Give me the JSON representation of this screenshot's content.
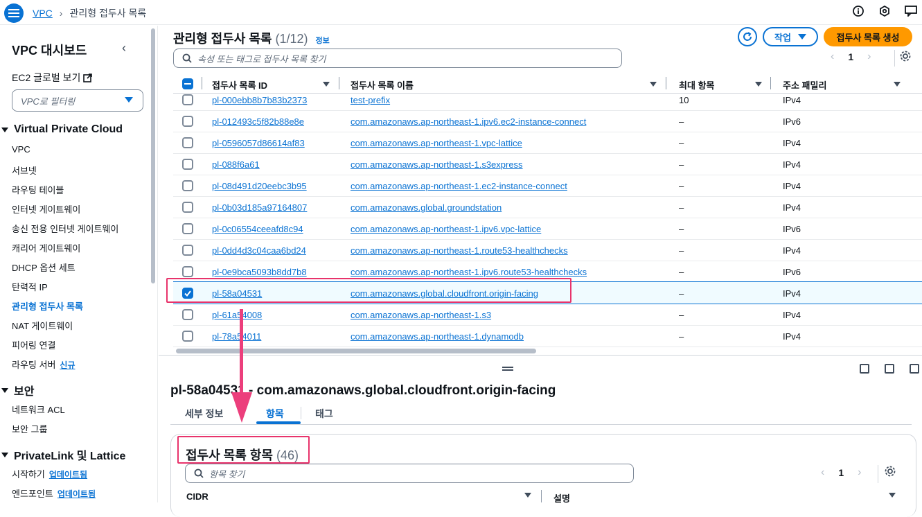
{
  "breadcrumb": {
    "root": "VPC",
    "current": "관리형 접두사 목록"
  },
  "sidebar": {
    "title": "VPC 대시보드",
    "ec2_global": "EC2 글로벌 보기",
    "filter_placeholder": "VPC로 필터링",
    "sections": {
      "vpc": "Virtual Private Cloud",
      "security": "보안",
      "privatelink": "PrivateLink 및 Lattice"
    },
    "items": [
      "VPC",
      "서브넷",
      "라우팅 테이블",
      "인터넷 게이트웨이",
      "송신 전용 인터넷 게이트웨이",
      "캐리어 게이트웨이",
      "DHCP 옵션 세트",
      "탄력적 IP",
      "관리형 접두사 목록",
      "NAT 게이트웨이",
      "피어링 연결",
      "라우팅 서버"
    ],
    "new_badge": "신규",
    "security_items": [
      "네트워크 ACL",
      "보안 그룹"
    ],
    "privatelink_items": [
      {
        "label": "시작하기",
        "badge": "업데이트됨"
      },
      {
        "label": "엔드포인트",
        "badge": "업데이트됨"
      }
    ]
  },
  "header": {
    "title": "관리형 접두사 목록",
    "count": "(1/12)",
    "info": "정보",
    "action": "작업",
    "create": "접두사 목록 생성",
    "search_placeholder": "속성 또는 태그로 접두사 목록 찾기",
    "page": "1"
  },
  "table": {
    "columns": [
      "접두사 목록 ID",
      "접두사 목록 이름",
      "최대 항목",
      "주소 패밀리"
    ],
    "rows": [
      {
        "id": "pl-000ebb8b7b83b2373",
        "name": "test-prefix",
        "max": "10",
        "family": "IPv4",
        "checked": false
      },
      {
        "id": "pl-012493c5f82b88e8e",
        "name": "com.amazonaws.ap-northeast-1.ipv6.ec2-instance-connect",
        "max": "–",
        "family": "IPv6",
        "checked": false
      },
      {
        "id": "pl-0596057d86614af83",
        "name": "com.amazonaws.ap-northeast-1.vpc-lattice",
        "max": "–",
        "family": "IPv4",
        "checked": false
      },
      {
        "id": "pl-088f6a61",
        "name": "com.amazonaws.ap-northeast-1.s3express",
        "max": "–",
        "family": "IPv4",
        "checked": false
      },
      {
        "id": "pl-08d491d20eebc3b95",
        "name": "com.amazonaws.ap-northeast-1.ec2-instance-connect",
        "max": "–",
        "family": "IPv4",
        "checked": false
      },
      {
        "id": "pl-0b03d185a97164807",
        "name": "com.amazonaws.global.groundstation",
        "max": "–",
        "family": "IPv4",
        "checked": false
      },
      {
        "id": "pl-0c06554ceeafd8c94",
        "name": "com.amazonaws.ap-northeast-1.ipv6.vpc-lattice",
        "max": "–",
        "family": "IPv6",
        "checked": false
      },
      {
        "id": "pl-0dd4d3c04caa6bd24",
        "name": "com.amazonaws.ap-northeast-1.route53-healthchecks",
        "max": "–",
        "family": "IPv4",
        "checked": false
      },
      {
        "id": "pl-0e9bca5093b8dd7b8",
        "name": "com.amazonaws.ap-northeast-1.ipv6.route53-healthchecks",
        "max": "–",
        "family": "IPv6",
        "checked": false
      },
      {
        "id": "pl-58a04531",
        "name": "com.amazonaws.global.cloudfront.origin-facing",
        "max": "–",
        "family": "IPv4",
        "checked": true
      },
      {
        "id": "pl-61a54008",
        "name": "com.amazonaws.ap-northeast-1.s3",
        "max": "–",
        "family": "IPv4",
        "checked": false
      },
      {
        "id": "pl-78a54011",
        "name": "com.amazonaws.ap-northeast-1.dynamodb",
        "max": "–",
        "family": "IPv4",
        "checked": false
      }
    ]
  },
  "detail": {
    "title": "pl-58a04531 - com.amazonaws.global.cloudfront.origin-facing",
    "tabs": [
      "세부 정보",
      "항목",
      "태그"
    ],
    "entries_title": "접두사 목록 항목",
    "entries_count": "(46)",
    "search_placeholder": "항목 찾기",
    "page": "1",
    "columns": [
      "CIDR",
      "설명"
    ]
  },
  "colors": {
    "accent": "#0972d3",
    "primary_button": "#ff9900",
    "annotation": "#e8336b"
  },
  "icons": [
    "menu-icon",
    "info-icon",
    "settings-icon",
    "feedback-icon",
    "refresh-icon",
    "search-icon",
    "gear-icon",
    "external-link-icon"
  ]
}
